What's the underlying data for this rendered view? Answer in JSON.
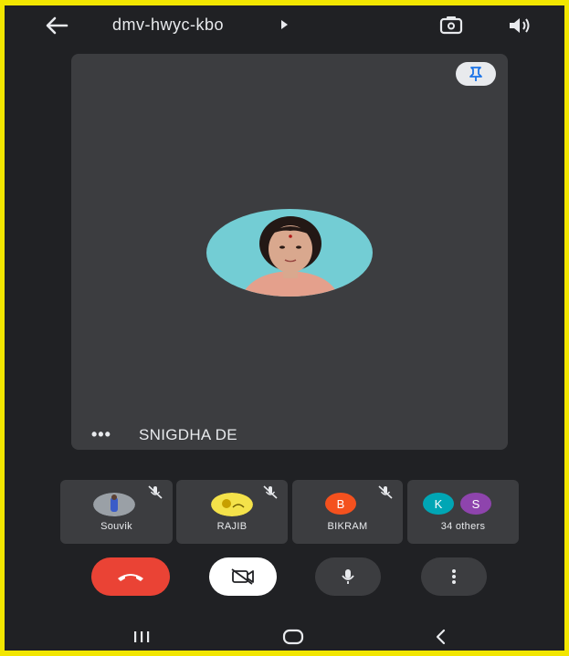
{
  "app": {
    "meeting_code": "dmv-hwyc-kbo"
  },
  "icons": {
    "back": "arrow-left-icon",
    "caret": "caret-right-icon",
    "switch_camera": "switch-camera-icon",
    "speaker": "speaker-icon",
    "pin": "pin-icon",
    "more": "more-horizontal-icon",
    "mic_off": "mic-off-icon"
  },
  "main_tile": {
    "speaker_name": "SNIGDHA DE",
    "more_label": "•••"
  },
  "participants": [
    {
      "name": "Souvik",
      "muted": true,
      "avatar": "photo"
    },
    {
      "name": "RAJIB",
      "muted": true,
      "avatar": "photo"
    },
    {
      "name": "BIKRAM",
      "muted": true,
      "avatar_letter": "B",
      "avatar_color": "#f4511e"
    },
    {
      "name": "34 others",
      "avatars": [
        {
          "letter": "K",
          "color": "#00a6b5"
        },
        {
          "letter": "S",
          "color": "#8e44ad"
        }
      ]
    }
  ],
  "controls": {
    "end_call_color": "#ea4335",
    "camera_state": "off",
    "mic_state": "on"
  },
  "nav": [
    "recent-apps",
    "home",
    "back"
  ]
}
